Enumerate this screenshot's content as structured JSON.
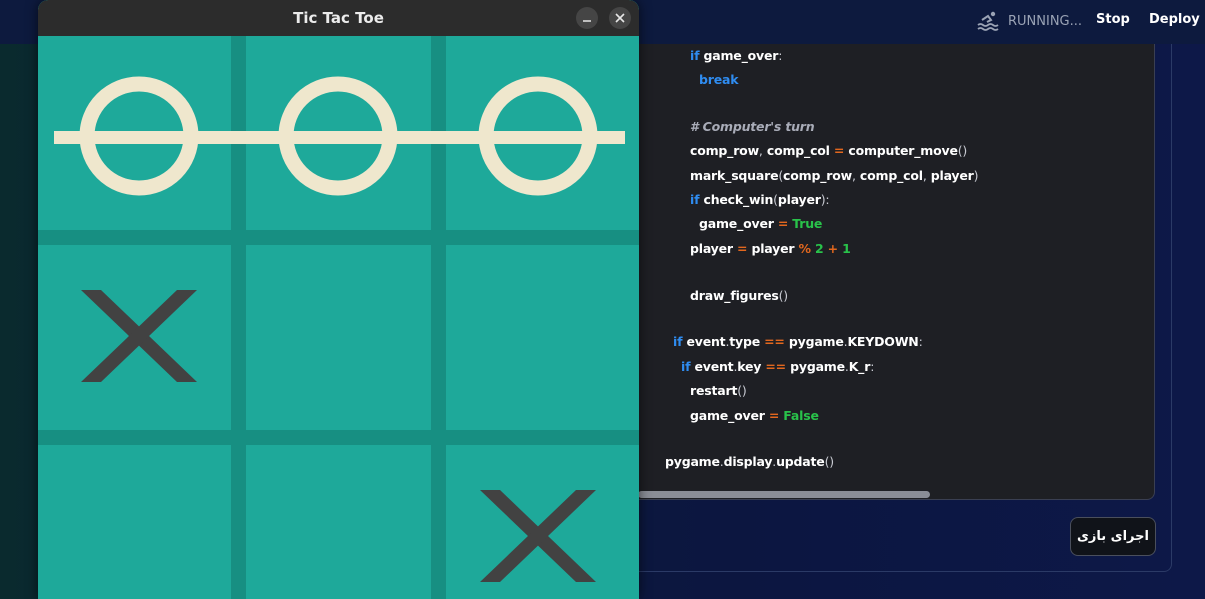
{
  "header": {
    "status_text": "RUNNING...",
    "stop_label": "Stop",
    "deploy_label": "Deploy"
  },
  "window": {
    "title": "Tic Tac Toe"
  },
  "board": {
    "cells": [
      [
        "O",
        "O",
        "O"
      ],
      [
        "X",
        "",
        ""
      ],
      [
        "",
        "",
        "X"
      ]
    ],
    "winning_line": "row-1",
    "colors": {
      "background": "#1ea99a",
      "lines": "#178f82",
      "circle": "#efe7cd",
      "cross": "#424242"
    }
  },
  "code": {
    "lines": [
      [
        [
          "kw",
          "if"
        ],
        [
          "t",
          " game_over"
        ],
        [
          "pu",
          ":"
        ]
      ],
      [
        [
          "kw",
          "break"
        ]
      ],
      [],
      [
        [
          "cm",
          "# Computer's turn"
        ]
      ],
      [
        [
          "t",
          "comp_row"
        ],
        [
          "pu",
          ","
        ],
        [
          "t",
          " comp_col "
        ],
        [
          "op",
          "="
        ],
        [
          "t",
          " computer_move"
        ],
        [
          "pu",
          "()"
        ]
      ],
      [
        [
          "t",
          "mark_square"
        ],
        [
          "pu",
          "("
        ],
        [
          "t",
          "comp_row"
        ],
        [
          "pu",
          ","
        ],
        [
          "t",
          " comp_col"
        ],
        [
          "pu",
          ","
        ],
        [
          "t",
          " player"
        ],
        [
          "pu",
          ")"
        ]
      ],
      [
        [
          "kw",
          "if"
        ],
        [
          "t",
          " check_win"
        ],
        [
          "pu",
          "("
        ],
        [
          "t",
          "player"
        ],
        [
          "pu",
          "):"
        ]
      ],
      [
        [
          "t",
          "game_over "
        ],
        [
          "op",
          "="
        ],
        [
          "tr",
          " True"
        ]
      ],
      [
        [
          "t",
          "player "
        ],
        [
          "op",
          "="
        ],
        [
          "t",
          " player "
        ],
        [
          "op",
          "%"
        ],
        [
          "tr",
          " 2 "
        ],
        [
          "op",
          "+"
        ],
        [
          "tr",
          " 1"
        ]
      ],
      [],
      [
        [
          "t",
          "draw_figures"
        ],
        [
          "pu",
          "()"
        ]
      ],
      [],
      [
        [
          "kw",
          "if"
        ],
        [
          "t",
          " event"
        ],
        [
          "pu",
          "."
        ],
        [
          "t",
          "type "
        ],
        [
          "op",
          "=="
        ],
        [
          "t",
          " pygame"
        ],
        [
          "pu",
          "."
        ],
        [
          "t",
          "KEYDOWN"
        ],
        [
          "pu",
          ":"
        ]
      ],
      [
        [
          "kw",
          "if"
        ],
        [
          "t",
          " event"
        ],
        [
          "pu",
          "."
        ],
        [
          "t",
          "key "
        ],
        [
          "op",
          "=="
        ],
        [
          "t",
          " pygame"
        ],
        [
          "pu",
          "."
        ],
        [
          "t",
          "K_r"
        ],
        [
          "pu",
          ":"
        ]
      ],
      [
        [
          "t",
          "restart"
        ],
        [
          "pu",
          "()"
        ]
      ],
      [
        [
          "t",
          "game_over "
        ],
        [
          "op",
          "="
        ],
        [
          "tr",
          " False"
        ]
      ],
      [],
      [
        [
          "t",
          "pygame"
        ],
        [
          "pu",
          "."
        ],
        [
          "t",
          "display"
        ],
        [
          "pu",
          "."
        ],
        [
          "t",
          "update"
        ],
        [
          "pu",
          "()"
        ]
      ]
    ]
  },
  "run_button_label": "اجرای بازی"
}
